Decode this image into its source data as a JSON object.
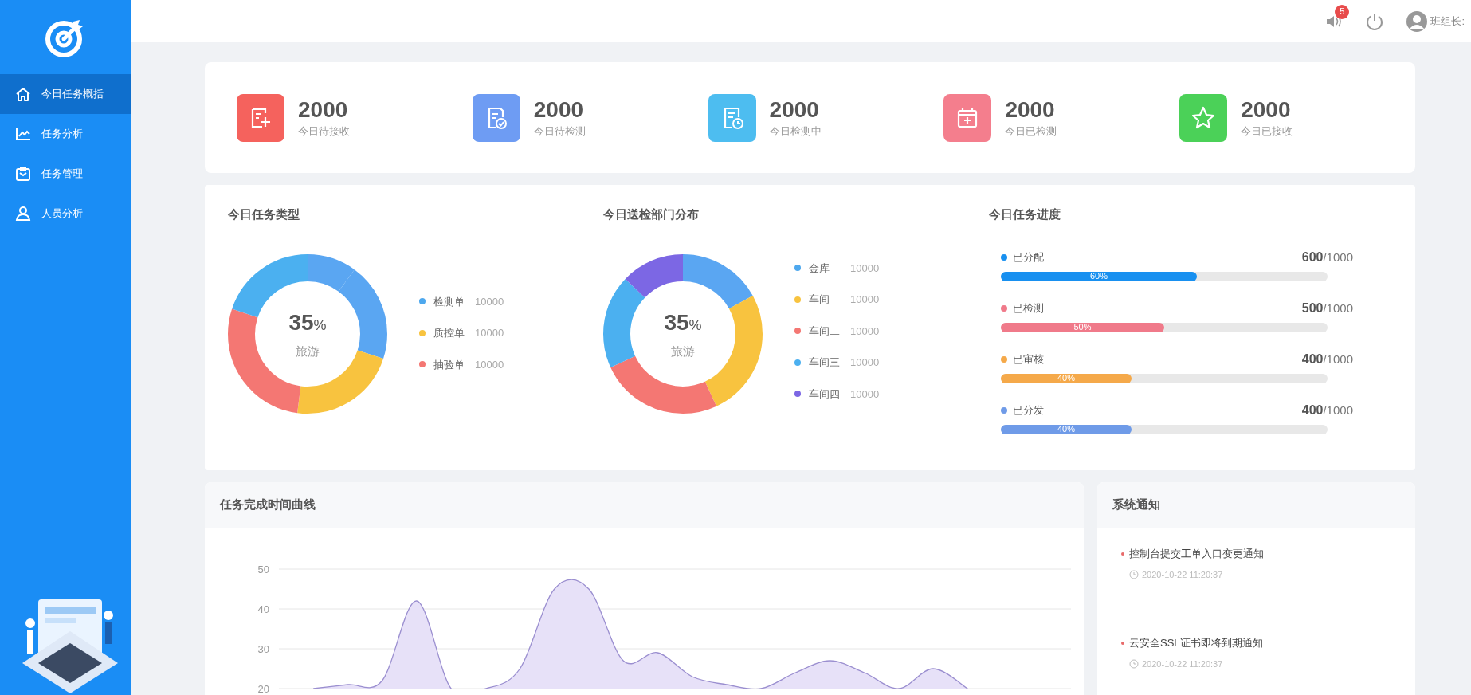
{
  "sidebar": {
    "items": [
      {
        "label": "今日任务概括",
        "selected": true
      },
      {
        "label": "任务分析",
        "selected": false
      },
      {
        "label": "任务管理",
        "selected": false
      },
      {
        "label": "人员分析",
        "selected": false
      }
    ]
  },
  "header": {
    "notification_count": "5",
    "user_label": "班组长:"
  },
  "stats": [
    {
      "value": "2000",
      "label": "今日待接收",
      "color": "#f5625d"
    },
    {
      "value": "2000",
      "label": "今日待检测",
      "color": "#6e9cf3"
    },
    {
      "value": "2000",
      "label": "今日检测中",
      "color": "#4dbdf0"
    },
    {
      "value": "2000",
      "label": "今日已检测",
      "color": "#f47e8d"
    },
    {
      "value": "2000",
      "label": "今日已接收",
      "color": "#4bd158"
    }
  ],
  "type_chart": {
    "title": "今日任务类型",
    "center_value": "35",
    "center_unit": "%",
    "center_label": "旅游",
    "legend": [
      {
        "label": "检测单",
        "value": "10000",
        "color": "#4ea8ee"
      },
      {
        "label": "质控单",
        "value": "10000",
        "color": "#f8c33f"
      },
      {
        "label": "抽验单",
        "value": "10000",
        "color": "#f47773"
      }
    ]
  },
  "dept_chart": {
    "title": "今日送检部门分布",
    "center_value": "35",
    "center_unit": "%",
    "center_label": "旅游",
    "legend": [
      {
        "label": "金库",
        "value": "10000",
        "color": "#4ea8ee"
      },
      {
        "label": "车间",
        "value": "10000",
        "color": "#f8c33f"
      },
      {
        "label": "车间二",
        "value": "10000",
        "color": "#f47773"
      },
      {
        "label": "车间三",
        "value": "10000",
        "color": "#4bb0f0"
      },
      {
        "label": "车间四",
        "value": "10000",
        "color": "#7c67e4"
      }
    ]
  },
  "progress": {
    "title": "今日任务进度",
    "items": [
      {
        "label": "已分配",
        "color": "#1890f0",
        "value": "600",
        "total": "/1000",
        "level": 0.6,
        "percent": "60%"
      },
      {
        "label": "已检测",
        "color": "#f07a8a",
        "value": "500",
        "total": "/1000",
        "level": 0.5,
        "percent": "50%"
      },
      {
        "label": "已审核",
        "color": "#f5a94a",
        "value": "400",
        "total": "/1000",
        "level": 0.4,
        "percent": "40%"
      },
      {
        "label": "已分发",
        "color": "#6f9be8",
        "value": "400",
        "total": "/1000",
        "level": 0.4,
        "percent": "40%"
      }
    ]
  },
  "curve": {
    "title": "任务完成时间曲线",
    "chart_data": {
      "type": "area",
      "ylim": [
        20,
        50
      ],
      "grid": true,
      "yticks": [
        20,
        30,
        40,
        50
      ],
      "series": [
        {
          "color": "#9b8fd0",
          "values": [
            null,
            20,
            21,
            22,
            42,
            20,
            20,
            25,
            45,
            45,
            27,
            29,
            23,
            21,
            20,
            24,
            27,
            24,
            20,
            25,
            20,
            null,
            null,
            null
          ]
        }
      ]
    }
  },
  "notices": {
    "title": "系统通知",
    "items": [
      {
        "title": "控制台提交工单入口变更通知",
        "time": "2020-10-22 11:20:37"
      },
      {
        "title": "云安全SSL证书即将到期通知",
        "time": "2020-10-22 11:20:37"
      }
    ]
  }
}
